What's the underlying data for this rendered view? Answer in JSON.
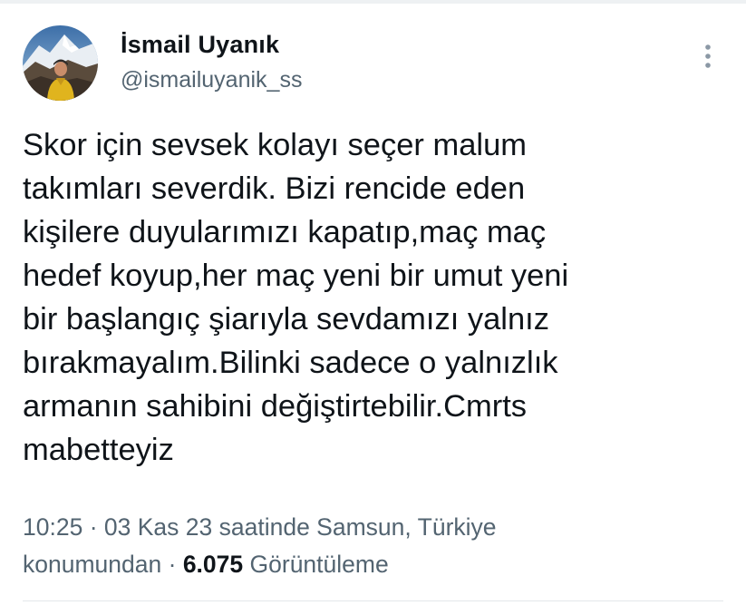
{
  "tweet": {
    "author": {
      "display_name": "İsmail Uyanık",
      "handle": "@ismailuyanik_ss",
      "avatar": "profile-photo"
    },
    "more_icon": "more-vertical-icon",
    "text": "Skor için sevsek kolayı seçer malum\ntakımları severdik. Bizi rencide eden\nkişilere duyularımızı kapatıp,maç maç\nhedef koyup,her maç yeni bir umut yeni\nbir başlangıç şiarıyla sevdamızı yalnız\nbırakmayalım.Bilinki sadece o yalnızlık\narmanın sahibini değiştirtebilir.Cmrts\nmabetteyiz",
    "meta": {
      "time": "10:25",
      "separator": "·",
      "date": "03 Kas 23",
      "location_line1": "saatinde Samsun, Türkiye",
      "location_line2": "konumundan",
      "views_count": "6.075",
      "views_label": "Görüntüleme"
    }
  },
  "colors": {
    "primary_text": "#0f1419",
    "secondary_text": "#536471",
    "divider": "#e3e7ea"
  }
}
